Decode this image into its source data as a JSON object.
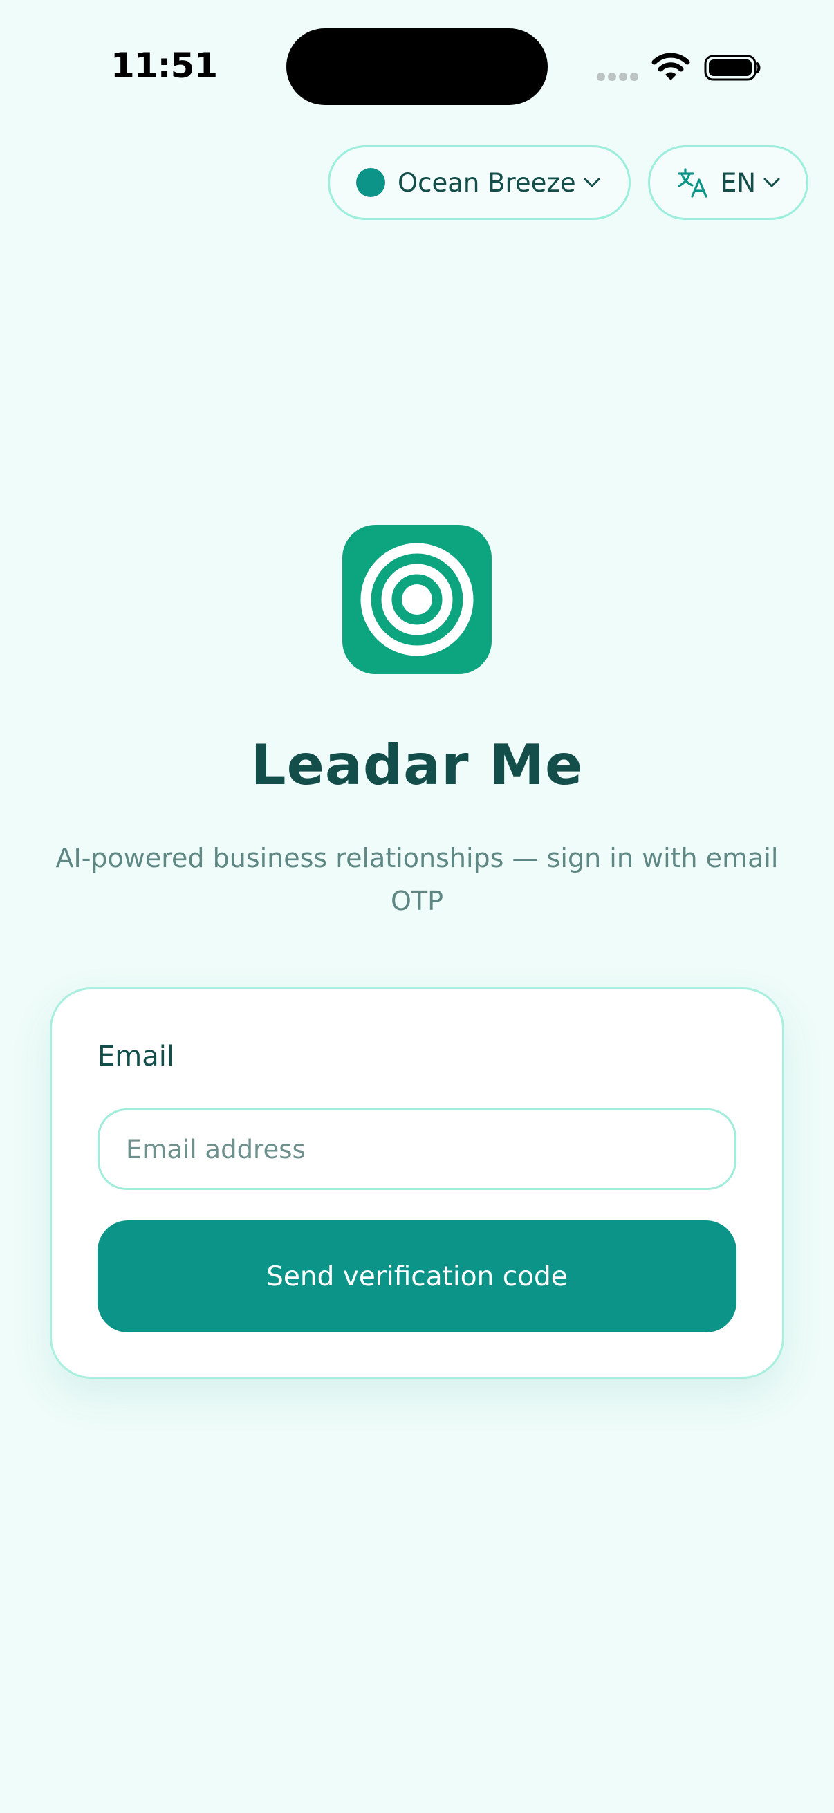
{
  "status_bar": {
    "time": "11:51"
  },
  "top_controls": {
    "theme_name": "Ocean Breeze",
    "language": "EN"
  },
  "branding": {
    "title": "Leadar Me",
    "subtitle": "AI-powered business relationships — sign in with email OTP"
  },
  "login_form": {
    "email_label": "Email",
    "email_placeholder": "Email address",
    "email_value": "",
    "submit_label": "Send verification code"
  },
  "colors": {
    "background": "#effcf9",
    "primary": "#0d9488",
    "logo": "#0ca57f",
    "text_dark": "#134e4a",
    "text_muted": "#5f8783",
    "border": "#9eeedd"
  },
  "icons": {
    "theme": "theme-color-dot-icon",
    "language": "translate-icon",
    "dropdown": "chevron-down-icon",
    "logo": "concentric-circles-icon"
  }
}
